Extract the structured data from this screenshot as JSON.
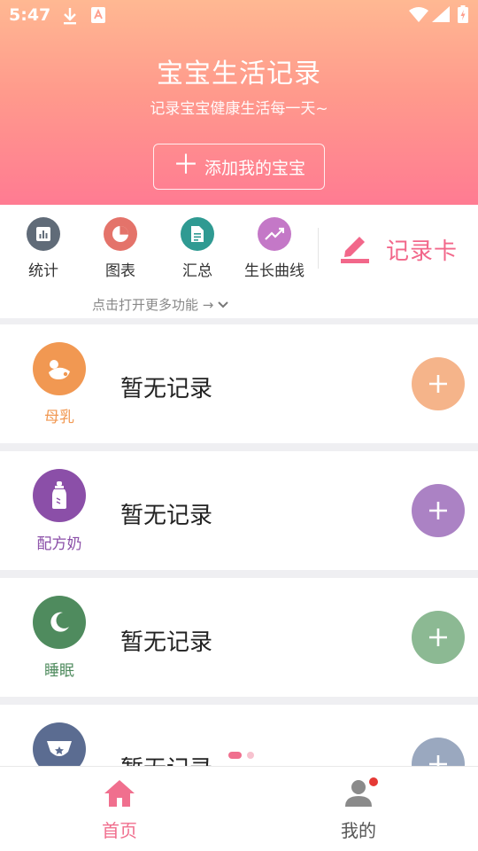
{
  "status_bar": {
    "time": "5:47"
  },
  "header": {
    "title": "宝宝生活记录",
    "subtitle": "记录宝宝健康生活每一天~",
    "add_baby_label": "添加我的宝宝"
  },
  "toolbar": {
    "tools": [
      {
        "label": "统计",
        "icon": "stats-icon",
        "color": "#606b78"
      },
      {
        "label": "图表",
        "icon": "pie-chart-icon",
        "color": "#e4736a"
      },
      {
        "label": "汇总",
        "icon": "document-icon",
        "color": "#2f9a92"
      },
      {
        "label": "生长曲线",
        "icon": "trend-icon",
        "color": "#c478c7"
      }
    ],
    "record_card_label": "记录卡",
    "more_hint": "点击打开更多功能 →"
  },
  "records": [
    {
      "name": "母乳",
      "status": "暂无记录",
      "icon": "breast-milk-icon",
      "color": "#f19852",
      "add_color": "#f5b48a"
    },
    {
      "name": "配方奶",
      "status": "暂无记录",
      "icon": "baby-bottle-icon",
      "color": "#8b4fa8",
      "add_color": "#ab82c4"
    },
    {
      "name": "睡眠",
      "status": "暂无记录",
      "icon": "moon-icon",
      "color": "#4f8b5e",
      "add_color": "#8cb993"
    },
    {
      "name": "",
      "status": "暂无记录",
      "icon": "diaper-icon",
      "color": "#5b6c91",
      "add_color": "#9aa8bf"
    }
  ],
  "bottom_nav": {
    "items": [
      {
        "label": "首页",
        "icon": "home-icon",
        "active": true
      },
      {
        "label": "我的",
        "icon": "profile-icon",
        "active": false
      }
    ],
    "active_color": "#f06f8e",
    "badge_color": "#e53935"
  }
}
